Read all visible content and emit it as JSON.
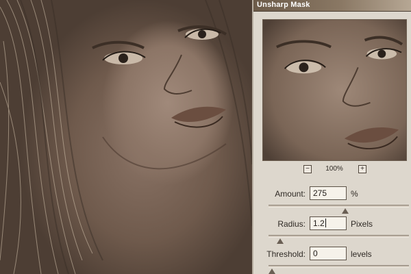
{
  "dialog": {
    "title": "Unsharp Mask",
    "zoom": {
      "minus": "−",
      "level": "100%",
      "plus": "+"
    },
    "amount": {
      "label": "Amount:",
      "value": "275",
      "unit": "%",
      "slider_fraction": 0.55
    },
    "radius": {
      "label": "Radius:",
      "value": "1.2",
      "unit": "Pixels",
      "slider_fraction": 0.06
    },
    "threshold": {
      "label": "Threshold:",
      "value": "0",
      "unit": "levels",
      "slider_fraction": 0.0
    }
  },
  "colors": {
    "photo_tone": "#8a7365",
    "dialog_bg": "#ddd7cd",
    "title_bar": "#6b5a48"
  }
}
